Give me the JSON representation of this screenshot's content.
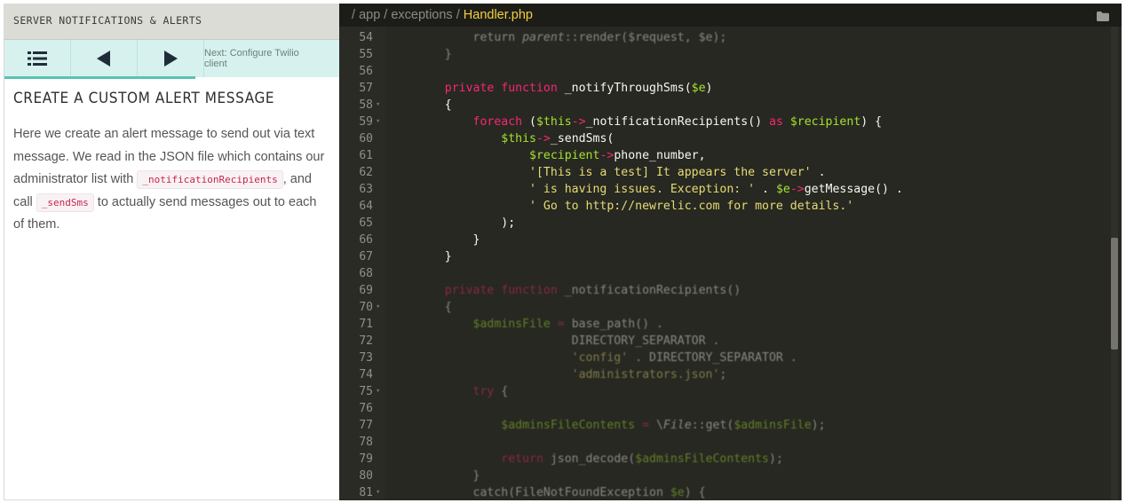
{
  "tutorial": {
    "header": "SERVER NOTIFICATIONS & ALERTS",
    "nav": {
      "menu_icon": "list-icon",
      "prev_icon": "triangle-left-icon",
      "next_icon": "triangle-right-icon",
      "next_label": "Next: Configure Twilio client",
      "progress_fraction": 0.57
    },
    "step_title": "CREATE A CUSTOM ALERT MESSAGE",
    "body": {
      "p1": "Here we create an alert message to send out via text message. We read in the JSON file which contains our administrator list with ",
      "code1": "_notificationRecipients",
      "p2": ", and call ",
      "code2": "_sendSms",
      "p3": " to actually send messages out to each of them."
    }
  },
  "editor": {
    "breadcrumb": {
      "sep1": "/ ",
      "dir1": "app",
      "sep2": " / ",
      "dir2": "exceptions",
      "sep3": " / ",
      "file": "Handler.php"
    },
    "folder_icon": "folder-icon",
    "colors": {
      "background": "#272822",
      "keyword": "#f92672",
      "variable": "#a6e22e",
      "string": "#e6db74"
    },
    "lines": [
      {
        "n": "54",
        "fold": false,
        "dim": true,
        "tokens": [
          [
            "",
            "        return "
          ],
          [
            "it",
            "parent"
          ],
          [
            "",
            "::render($request, $e);"
          ]
        ]
      },
      {
        "n": "55",
        "fold": false,
        "dim": true,
        "tokens": [
          [
            "",
            "    }"
          ]
        ]
      },
      {
        "n": "56",
        "fold": false,
        "dim": true,
        "tokens": [
          [
            "",
            ""
          ]
        ]
      },
      {
        "n": "57",
        "fold": false,
        "dim": false,
        "tokens": [
          [
            "kw",
            "    private function "
          ],
          [
            "",
            "_notifyThroughSms("
          ],
          [
            "var",
            "$e"
          ],
          [
            "",
            ")"
          ]
        ]
      },
      {
        "n": "58",
        "fold": true,
        "dim": false,
        "tokens": [
          [
            "",
            "    {"
          ]
        ]
      },
      {
        "n": "59",
        "fold": true,
        "dim": false,
        "tokens": [
          [
            "kw",
            "        foreach "
          ],
          [
            "",
            "("
          ],
          [
            "var",
            "$this"
          ],
          [
            "kw",
            "->"
          ],
          [
            "",
            "_notificationRecipients() "
          ],
          [
            "kw",
            "as "
          ],
          [
            "var",
            "$recipient"
          ],
          [
            "",
            ") {"
          ]
        ]
      },
      {
        "n": "60",
        "fold": false,
        "dim": false,
        "tokens": [
          [
            "var",
            "            $this"
          ],
          [
            "kw",
            "->"
          ],
          [
            "",
            "_sendSms("
          ]
        ]
      },
      {
        "n": "61",
        "fold": false,
        "dim": false,
        "tokens": [
          [
            "var",
            "                $recipient"
          ],
          [
            "kw",
            "->"
          ],
          [
            "",
            "phone_number,"
          ]
        ]
      },
      {
        "n": "62",
        "fold": false,
        "dim": false,
        "tokens": [
          [
            "str",
            "                '[This is a test] It appears the server' "
          ],
          [
            "",
            "."
          ]
        ]
      },
      {
        "n": "63",
        "fold": false,
        "dim": false,
        "tokens": [
          [
            "str",
            "                ' is having issues. Exception: ' "
          ],
          [
            "",
            ". "
          ],
          [
            "var",
            "$e"
          ],
          [
            "kw",
            "->"
          ],
          [
            "",
            "getMessage() ."
          ]
        ]
      },
      {
        "n": "64",
        "fold": false,
        "dim": false,
        "tokens": [
          [
            "str",
            "                ' Go to http://newrelic.com for more details.'"
          ]
        ]
      },
      {
        "n": "65",
        "fold": false,
        "dim": false,
        "tokens": [
          [
            "",
            "            );"
          ]
        ]
      },
      {
        "n": "66",
        "fold": false,
        "dim": false,
        "tokens": [
          [
            "",
            "        }"
          ]
        ]
      },
      {
        "n": "67",
        "fold": false,
        "dim": false,
        "tokens": [
          [
            "",
            "    }"
          ]
        ]
      },
      {
        "n": "68",
        "fold": false,
        "dim": true,
        "tokens": [
          [
            "",
            ""
          ]
        ]
      },
      {
        "n": "69",
        "fold": false,
        "dim": true,
        "tokens": [
          [
            "kw",
            "    private function "
          ],
          [
            "",
            "_notificationRecipients()"
          ]
        ]
      },
      {
        "n": "70",
        "fold": true,
        "dim": true,
        "tokens": [
          [
            "",
            "    {"
          ]
        ]
      },
      {
        "n": "71",
        "fold": false,
        "dim": true,
        "tokens": [
          [
            "var",
            "        $adminsFile "
          ],
          [
            "kw",
            "= "
          ],
          [
            "",
            "base_path() ."
          ]
        ]
      },
      {
        "n": "72",
        "fold": false,
        "dim": true,
        "tokens": [
          [
            "",
            "                      DIRECTORY_SEPARATOR ."
          ]
        ]
      },
      {
        "n": "73",
        "fold": false,
        "dim": true,
        "tokens": [
          [
            "str",
            "                      'config' "
          ],
          [
            "",
            ". DIRECTORY_SEPARATOR ."
          ]
        ]
      },
      {
        "n": "74",
        "fold": false,
        "dim": true,
        "tokens": [
          [
            "str",
            "                      'administrators.json'"
          ],
          [
            "",
            ";"
          ]
        ]
      },
      {
        "n": "75",
        "fold": true,
        "dim": true,
        "tokens": [
          [
            "kw",
            "        try "
          ],
          [
            "",
            "{"
          ]
        ]
      },
      {
        "n": "76",
        "fold": false,
        "dim": true,
        "tokens": [
          [
            "",
            ""
          ]
        ]
      },
      {
        "n": "77",
        "fold": false,
        "dim": true,
        "tokens": [
          [
            "var",
            "            $adminsFileContents "
          ],
          [
            "kw",
            "= "
          ],
          [
            "",
            "\\"
          ],
          [
            "it",
            "File"
          ],
          [
            "",
            "::get("
          ],
          [
            "var",
            "$adminsFile"
          ],
          [
            "",
            ");"
          ]
        ]
      },
      {
        "n": "78",
        "fold": false,
        "dim": true,
        "tokens": [
          [
            "",
            ""
          ]
        ]
      },
      {
        "n": "79",
        "fold": false,
        "dim": true,
        "tokens": [
          [
            "kw",
            "            return "
          ],
          [
            "",
            "json_decode("
          ],
          [
            "var",
            "$adminsFileContents"
          ],
          [
            "",
            ");"
          ]
        ]
      },
      {
        "n": "80",
        "fold": false,
        "dim": true,
        "tokens": [
          [
            "",
            "        }"
          ]
        ]
      },
      {
        "n": "81",
        "fold": true,
        "dim": true,
        "tokens": [
          [
            "",
            "        catch(FileNotFoundException "
          ],
          [
            "var",
            "$e"
          ],
          [
            "",
            ") {"
          ]
        ]
      }
    ]
  }
}
